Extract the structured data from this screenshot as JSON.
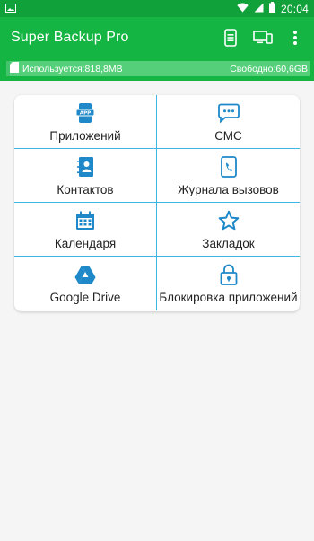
{
  "status_bar": {
    "time": "20:04"
  },
  "app": {
    "title": "Super Backup Pro",
    "actions": [
      {
        "icon": "phone-storage-icon"
      },
      {
        "icon": "devices-icon"
      },
      {
        "icon": "more-vert-icon"
      }
    ]
  },
  "storage": {
    "used_text": "Используется:818,8MB",
    "free_text": "Свободно:60,6GB",
    "used_fraction": 0.013
  },
  "grid": [
    {
      "label": "Приложений",
      "icon": "app-icon"
    },
    {
      "label": "СМС",
      "icon": "sms-icon"
    },
    {
      "label": "Контактов",
      "icon": "contacts-icon"
    },
    {
      "label": "Журнала вызовов",
      "icon": "call-log-icon"
    },
    {
      "label": "Календаря",
      "icon": "calendar-icon"
    },
    {
      "label": "Закладок",
      "icon": "star-icon"
    },
    {
      "label": "Google Drive",
      "icon": "google-drive-icon"
    },
    {
      "label": "Блокировка приложений",
      "icon": "lock-icon"
    }
  ],
  "colors": {
    "primary": "#15b543",
    "accent": "#1e88c8",
    "divider": "#3fb6e6"
  }
}
